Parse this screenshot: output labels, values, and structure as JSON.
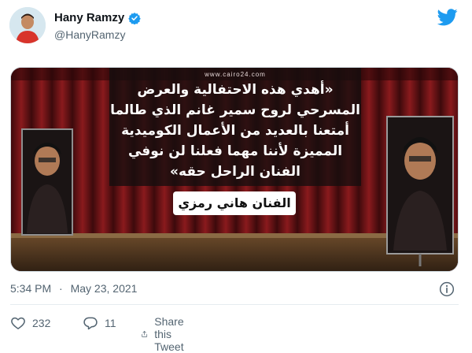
{
  "author": {
    "display_name": "Hany Ramzy",
    "handle": "@HanyRamzy"
  },
  "media": {
    "watermark": "www.cairo24.com",
    "quote_lines": [
      "«أهدي هذه الاحتفالية والعرض",
      "المسرحي لروح سمير غانم الذي طالما",
      "أمتعنا بالعديد من الأعمال الكوميدية",
      "المميزة لأننا مهما فعلنا لن نوفي",
      "الفنان الراحل حقه»"
    ],
    "caption": "الفنان هاني رمزي"
  },
  "meta": {
    "time": "5:34 PM",
    "separator": "·",
    "date": "May 23, 2021"
  },
  "actions": {
    "like_count": "232",
    "reply_count": "11",
    "share_label": "Share this Tweet"
  },
  "icons": {
    "verified": "verified-badge-icon",
    "brand": "twitter-bird-icon",
    "info": "info-icon",
    "like": "heart-icon",
    "reply": "reply-bubble-icon",
    "share": "share-icon"
  },
  "colors": {
    "brand_blue": "#1d9bf0",
    "text_primary": "#0f1419",
    "text_secondary": "#536471",
    "curtain_red": "#7a1417"
  }
}
